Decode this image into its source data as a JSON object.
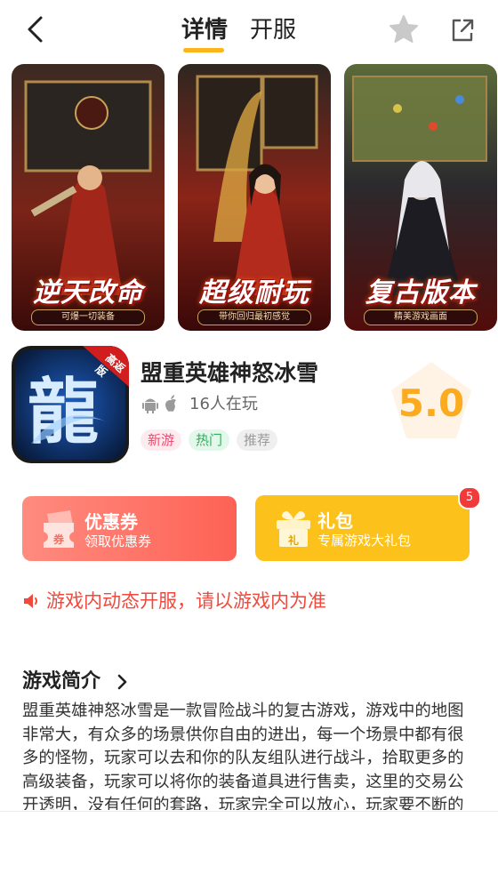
{
  "header": {
    "tabs": [
      {
        "label": "详情",
        "active": true
      },
      {
        "label": "开服",
        "active": false
      }
    ],
    "icons": {
      "back": "back-arrow-icon",
      "favorite": "star-icon",
      "share": "share-icon"
    }
  },
  "screenshots": [
    {
      "caption": "逆天改命",
      "subcaption": "可爆一切装备"
    },
    {
      "caption": "超级耐玩",
      "subcaption": "带你回归最初感觉"
    },
    {
      "caption": "复古版本",
      "subcaption": "精美游戏画面"
    }
  ],
  "game": {
    "icon_badge": "高返版",
    "title": "盟重英雄神怒冰雪",
    "players": "16人在玩",
    "platforms": [
      "android-icon",
      "apple-icon"
    ],
    "tags": [
      "新游",
      "热门",
      "推荐"
    ],
    "score": "5.0"
  },
  "actions": {
    "coupon": {
      "title": "优惠券",
      "subtitle": "领取优惠券",
      "icon_text": "券"
    },
    "gift": {
      "title": "礼包",
      "subtitle": "专属游戏大礼包",
      "icon_text": "礼",
      "badge": "5"
    }
  },
  "notice": "游戏内动态开服，请以游戏内为准",
  "intro": {
    "title": "游戏简介",
    "text": "盟重英雄神怒冰雪是一款冒险战斗的复古游戏，游戏中的地图非常大，有众多的场景供你自由的进出，每一个场景中都有很多的怪物，玩家可以去和你的队友组队进行战斗，拾取更多的高级装备，玩家可以将你的装备道具进行售卖，这里的交易公开透明，没有任何的套路，玩家完全可以放心，玩家要不断的完成任务，提高自己的战斗力。"
  },
  "colors": {
    "accent": "#fcb51a",
    "coupon": "#fd6a5c",
    "gift": "#fcc21b",
    "notice": "#f04a3e",
    "score": "#fcab1f"
  }
}
